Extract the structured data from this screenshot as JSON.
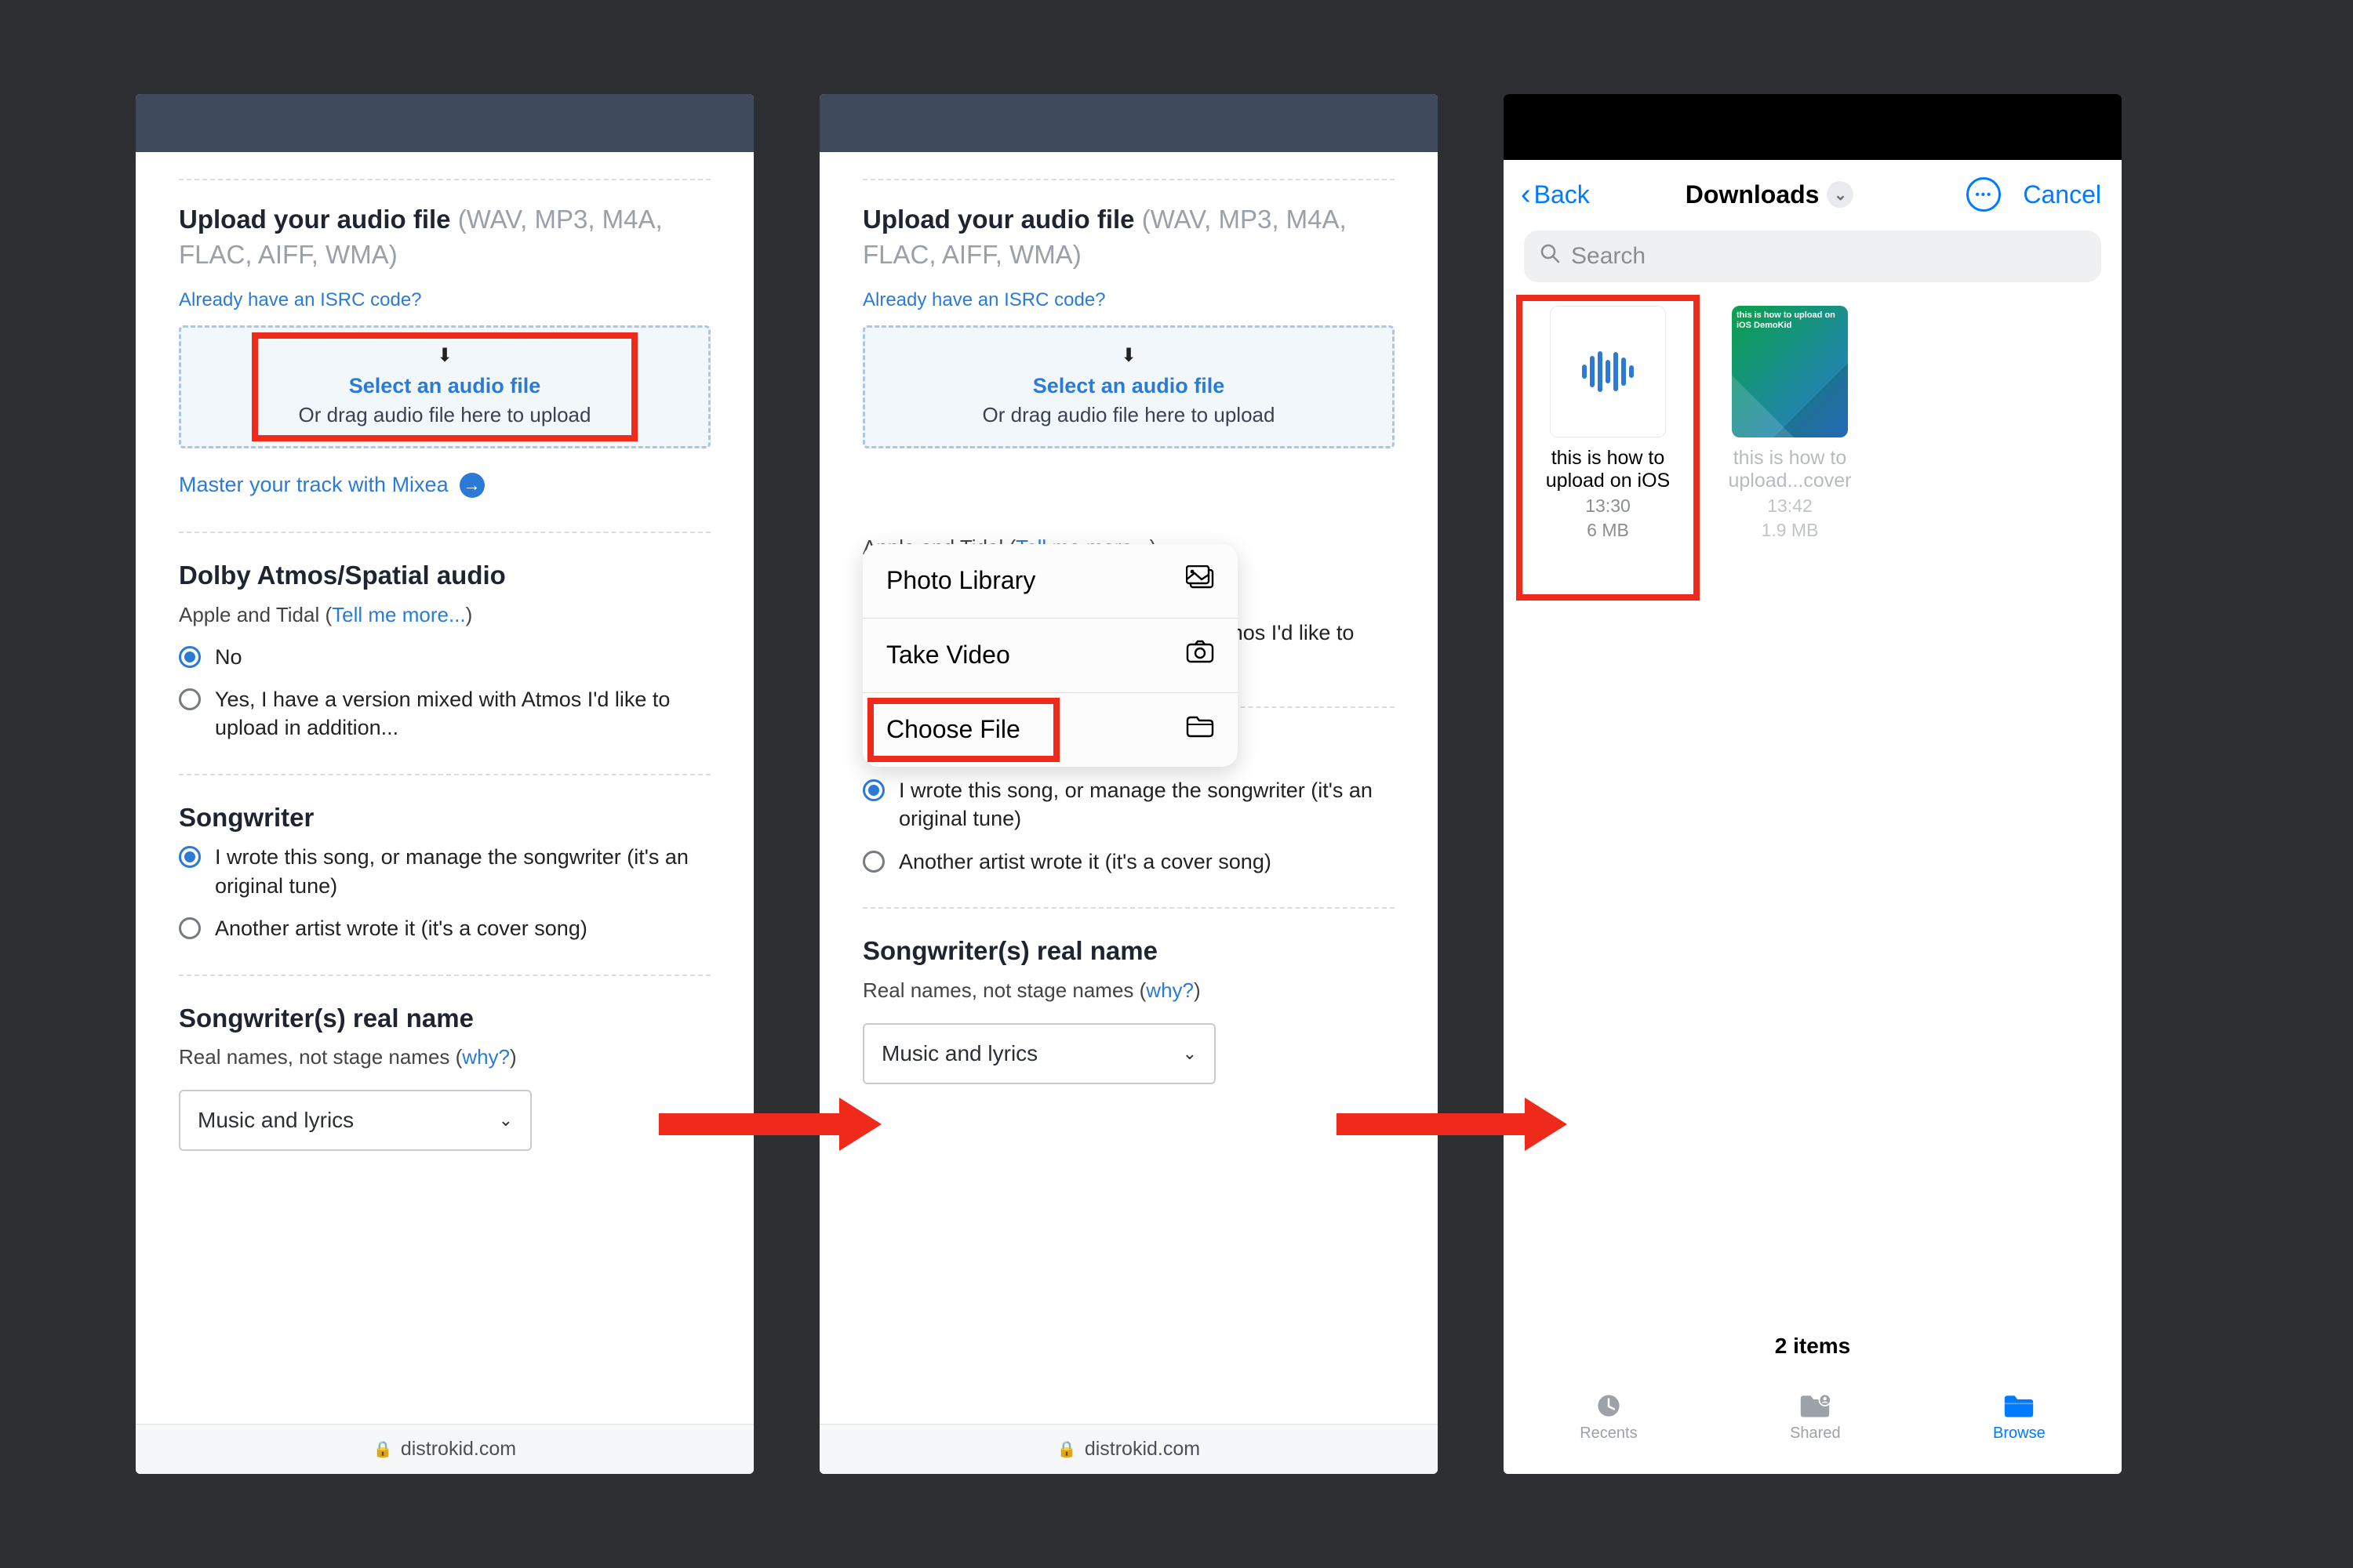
{
  "upload": {
    "heading": "Upload your audio file",
    "formats": "(WAV, MP3, M4A, FLAC, AIFF, WMA)",
    "isrc_link": "Already have an ISRC code?",
    "select_label": "Select an audio file",
    "drag_hint": "Or drag audio file here to upload",
    "mixea": "Master your track with Mixea"
  },
  "dolby": {
    "heading": "Dolby Atmos/Spatial audio",
    "caption_prefix": "Apple and Tidal (",
    "caption_link": "Tell me more...",
    "caption_suffix": ")",
    "no": "No",
    "yes": "Yes, I have a version mixed with Atmos I'd like to upload in addition..."
  },
  "songwriter": {
    "heading": "Songwriter",
    "opt1": "I wrote this song, or manage the songwriter (it's an original tune)",
    "opt2": "Another artist wrote it (it's a cover song)"
  },
  "realname": {
    "heading": "Songwriter(s) real name",
    "caption_prefix": "Real names, not stage names (",
    "caption_link": "why?",
    "caption_suffix": ")",
    "select_value": "Music and lyrics"
  },
  "footer_domain": "distrokid.com",
  "actionsheet": {
    "photo": "Photo Library",
    "video": "Take Video",
    "file": "Choose File"
  },
  "picker": {
    "back": "Back",
    "title": "Downloads",
    "cancel": "Cancel",
    "search_placeholder": "Search",
    "items_count": "2 items",
    "file1_name": "this is how to upload on iOS",
    "file1_time": "13:30",
    "file1_size": "6 MB",
    "file2_name": "this is how to upload...cover",
    "file2_time": "13:42",
    "file2_size": "1.9 MB",
    "thumb_overlay": "this is how to upload on iOS DemoKid",
    "tabs": {
      "recents": "Recents",
      "shared": "Shared",
      "browse": "Browse"
    }
  }
}
